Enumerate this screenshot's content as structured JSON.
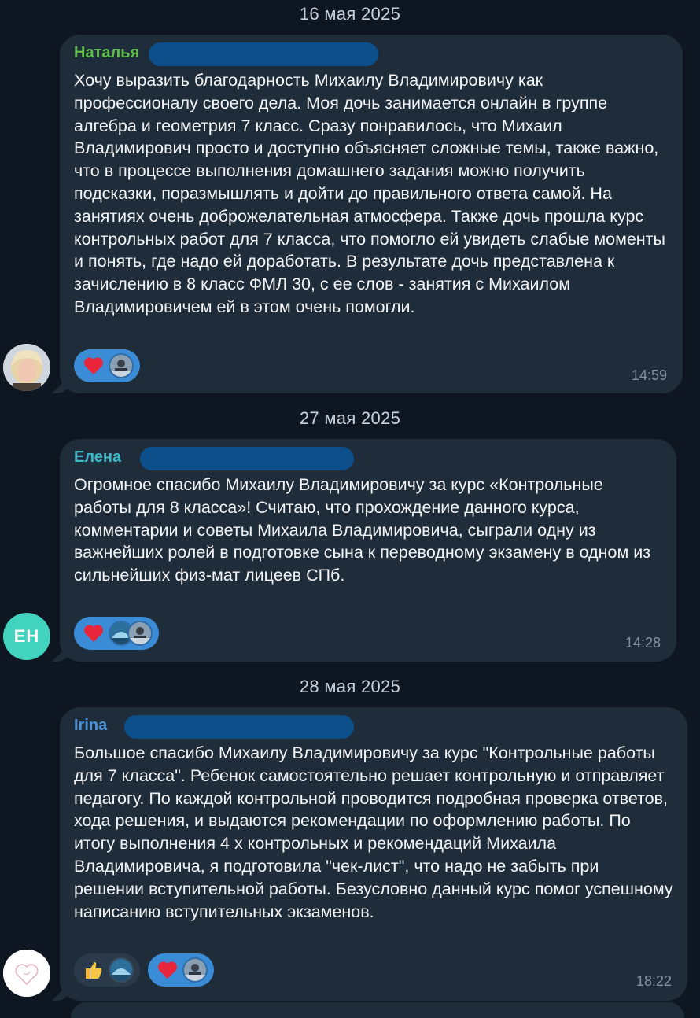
{
  "messages": [
    {
      "date": "16 мая 2025",
      "sender": "Наталья",
      "sender_color": "#5fbf4a",
      "text": "Хочу выразить благодарность Михаилу Владимировичу как профессионалу своего дела. Моя дочь занимается онлайн в группе алгебра и геометрия 7 класс. Сразу понравилось, что Михаил Владимирович просто и доступно объясняет сложные темы, также важно, что в процессе выполнения домашнего задания можно получить подсказки, поразмышлять и дойти до правильного ответа самой. На занятиях очень доброжелательная атмосфера. Также дочь прошла курс контрольных работ для 7 класса, что помогло ей увидеть слабые моменты и понять, где надо ей доработать. В результате дочь представлена к зачислению в 8 класс ФМЛ 30, с ее слов - занятия с Михаилом Владимировичем ей в этом очень помогли.",
      "reactions": [
        "heart-icon"
      ],
      "time": "14:59",
      "avatar": "photo"
    },
    {
      "date": "27 мая 2025",
      "sender": "Елена",
      "sender_color": "#3fb7c6",
      "text": "Огромное спасибо Михаилу Владимировичу за курс «Контрольные работы для 8 класса»! Считаю, что прохождение данного курса, комментарии и советы Михаила Владимировича, сыграли одну из важнейших ролей в подготовке сына к переводному экзамену в одном из сильнейших физ-мат лицеев СПб.",
      "reactions": [
        "heart-icon"
      ],
      "time": "14:28",
      "avatar_initials": "ЕН"
    },
    {
      "date": "28 мая 2025",
      "sender": "Irina",
      "sender_color": "#4a93d9",
      "text": "Большое спасибо Михаилу Владимировичу за курс \"Контрольные работы для 7 класса\". Ребенок самостоятельно решает контрольную и отправляет педагогу. По каждой контрольной проводится подробная проверка ответов, хода решения, и выдаются рекомендации по оформлению работы. По итогу выполнения 4 х контрольных и рекомендаций Михаила Владимировича, я подготовила \"чек-лист\", что надо не забыть при решении вступительной работы. Безусловно данный курс помог успешному написанию вступительных экзаменов.",
      "reactions": [
        "thumbs-up-icon",
        "heart-icon"
      ],
      "time": "18:22",
      "avatar": "heart-logo"
    }
  ],
  "colors": {
    "background": "#0e1621",
    "bubble": "#1f2c3a",
    "reaction_active": "#3b8cd6",
    "reaction_muted": "#2b3a4a",
    "heart": "#e8253a"
  }
}
